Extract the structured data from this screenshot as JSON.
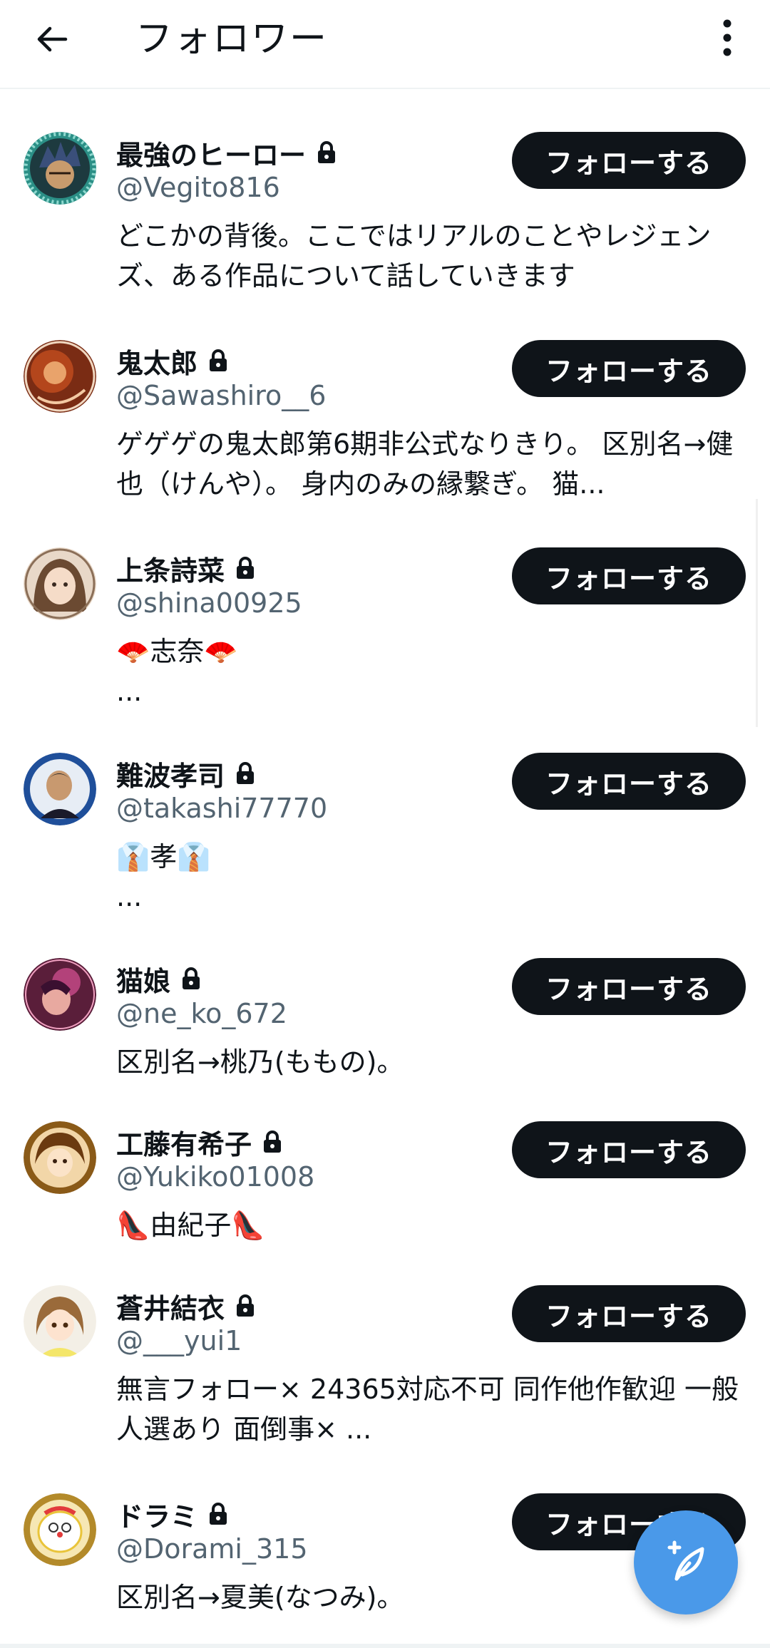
{
  "header": {
    "title": "フォロワー",
    "back_icon": "arrow-left-icon",
    "more_icon": "more-vertical-icon"
  },
  "colors": {
    "follow_button_bg": "#0f1419",
    "handle_text": "#536471",
    "fab_bg": "#4a99e9"
  },
  "followers": [
    {
      "name": "最強のヒーロー",
      "handle": "@Vegito816",
      "bio": "どこかの背後。ここではリアルのことやレジェンズ、ある作品について話していきます",
      "protected": true,
      "follow_label": "フォローする"
    },
    {
      "name": "鬼太郎",
      "handle": "@Sawashiro__6",
      "bio": "ゲゲゲの鬼太郎第6期非公式なりきり。 区別名→健也（けんや）。 身内のみの縁繋ぎ。 猫...",
      "protected": true,
      "follow_label": "フォローする"
    },
    {
      "name": "上条詩菜",
      "handle": "@shina00925",
      "bio": "🪭志奈🪭\n...",
      "protected": true,
      "follow_label": "フォローする"
    },
    {
      "name": "難波孝司",
      "handle": "@takashi77770",
      "bio": "👔孝👔\n...",
      "protected": true,
      "follow_label": "フォローする"
    },
    {
      "name": "猫娘",
      "handle": "@ne_ko_672",
      "bio": "区別名→桃乃(ももの)。",
      "protected": true,
      "follow_label": "フォローする"
    },
    {
      "name": "工藤有希子",
      "handle": "@Yukiko01008",
      "bio": "👠由紀子👠",
      "protected": true,
      "follow_label": "フォローする"
    },
    {
      "name": "蒼井結衣",
      "handle": "@___yui1",
      "bio": "無言フォロー× 24365対応不可 同作他作歓迎 一般人選あり 面倒事× ...",
      "protected": true,
      "follow_label": "フォローする"
    },
    {
      "name": "ドラミ",
      "handle": "@Dorami_315",
      "bio": "区別名→夏美(なつみ)。",
      "protected": true,
      "follow_label": "フォローする"
    }
  ],
  "fab": {
    "icon": "compose-feather-plus-icon"
  }
}
